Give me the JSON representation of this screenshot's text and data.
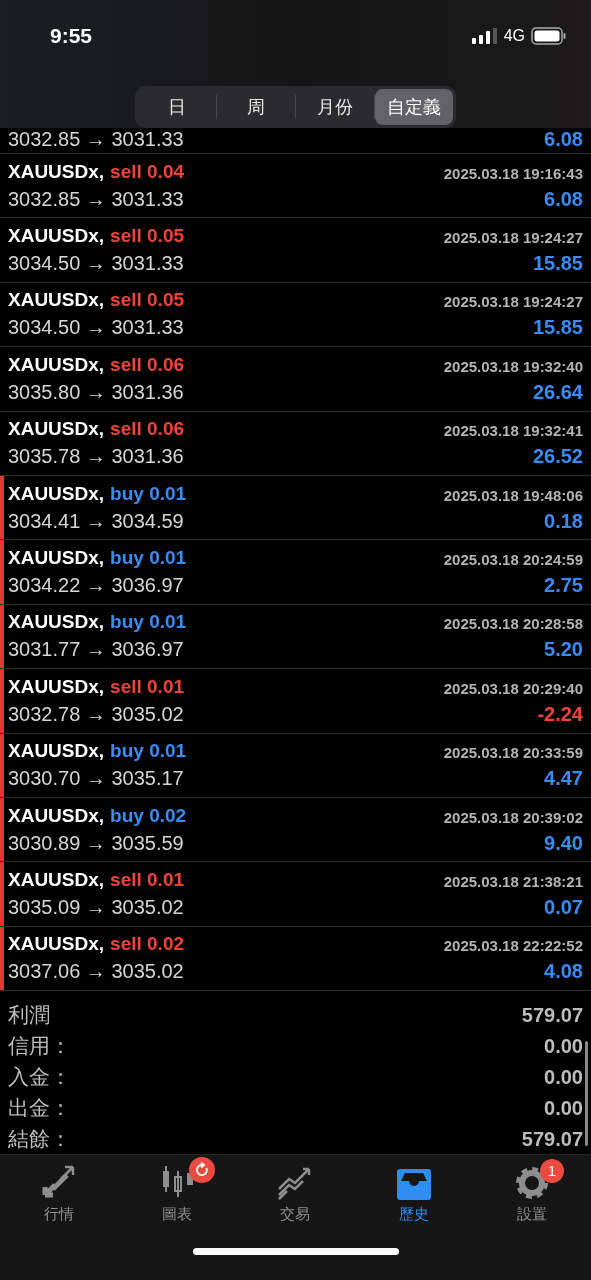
{
  "status_bar": {
    "time": "9:55",
    "network": "4G"
  },
  "period_tabs": [
    {
      "label": "日",
      "selected": false
    },
    {
      "label": "周",
      "selected": false
    },
    {
      "label": "月份",
      "selected": false
    },
    {
      "label": "自定義",
      "selected": true
    }
  ],
  "top_row": {
    "prices": "3032.85 → 3031.33",
    "profit": "6.08",
    "loss": false
  },
  "deals": [
    {
      "symbol": "XAUUSDx,",
      "order": "sell 0.04",
      "kind": "sell",
      "time": "2025.03.18 19:16:43",
      "prices": "3032.85 → 3031.33",
      "profit": "6.08",
      "loss": false,
      "flagged": false
    },
    {
      "symbol": "XAUUSDx,",
      "order": "sell 0.05",
      "kind": "sell",
      "time": "2025.03.18 19:24:27",
      "prices": "3034.50 → 3031.33",
      "profit": "15.85",
      "loss": false,
      "flagged": false
    },
    {
      "symbol": "XAUUSDx,",
      "order": "sell 0.05",
      "kind": "sell",
      "time": "2025.03.18 19:24:27",
      "prices": "3034.50 → 3031.33",
      "profit": "15.85",
      "loss": false,
      "flagged": false
    },
    {
      "symbol": "XAUUSDx,",
      "order": "sell 0.06",
      "kind": "sell",
      "time": "2025.03.18 19:32:40",
      "prices": "3035.80 → 3031.36",
      "profit": "26.64",
      "loss": false,
      "flagged": false
    },
    {
      "symbol": "XAUUSDx,",
      "order": "sell 0.06",
      "kind": "sell",
      "time": "2025.03.18 19:32:41",
      "prices": "3035.78 → 3031.36",
      "profit": "26.52",
      "loss": false,
      "flagged": false
    },
    {
      "symbol": "XAUUSDx,",
      "order": "buy 0.01",
      "kind": "buy",
      "time": "2025.03.18 19:48:06",
      "prices": "3034.41 → 3034.59",
      "profit": "0.18",
      "loss": false,
      "flagged": true
    },
    {
      "symbol": "XAUUSDx,",
      "order": "buy 0.01",
      "kind": "buy",
      "time": "2025.03.18 20:24:59",
      "prices": "3034.22 → 3036.97",
      "profit": "2.75",
      "loss": false,
      "flagged": true
    },
    {
      "symbol": "XAUUSDx,",
      "order": "buy 0.01",
      "kind": "buy",
      "time": "2025.03.18 20:28:58",
      "prices": "3031.77 → 3036.97",
      "profit": "5.20",
      "loss": false,
      "flagged": true
    },
    {
      "symbol": "XAUUSDx,",
      "order": "sell 0.01",
      "kind": "sell",
      "time": "2025.03.18 20:29:40",
      "prices": "3032.78 → 3035.02",
      "profit": "-2.24",
      "loss": true,
      "flagged": true
    },
    {
      "symbol": "XAUUSDx,",
      "order": "buy 0.01",
      "kind": "buy",
      "time": "2025.03.18 20:33:59",
      "prices": "3030.70 → 3035.17",
      "profit": "4.47",
      "loss": false,
      "flagged": true
    },
    {
      "symbol": "XAUUSDx,",
      "order": "buy 0.02",
      "kind": "buy",
      "time": "2025.03.18 20:39:02",
      "prices": "3030.89 → 3035.59",
      "profit": "9.40",
      "loss": false,
      "flagged": true
    },
    {
      "symbol": "XAUUSDx,",
      "order": "sell 0.01",
      "kind": "sell",
      "time": "2025.03.18 21:38:21",
      "prices": "3035.09 → 3035.02",
      "profit": "0.07",
      "loss": false,
      "flagged": true
    },
    {
      "symbol": "XAUUSDx,",
      "order": "sell 0.02",
      "kind": "sell",
      "time": "2025.03.18 22:22:52",
      "prices": "3037.06 → 3035.02",
      "profit": "4.08",
      "loss": false,
      "flagged": true
    }
  ],
  "summary": [
    {
      "label": "利潤",
      "value": "579.07"
    },
    {
      "label": "信用：",
      "value": "0.00"
    },
    {
      "label": "入金：",
      "value": "0.00"
    },
    {
      "label": "出金：",
      "value": "0.00"
    },
    {
      "label": "結餘：",
      "value": "579.07"
    }
  ],
  "tab_bar": [
    {
      "label": "行情",
      "kind": "quotes",
      "selected": false
    },
    {
      "label": "圖表",
      "kind": "chart",
      "selected": false,
      "refresh_badge": true
    },
    {
      "label": "交易",
      "kind": "trade",
      "selected": false
    },
    {
      "label": "歷史",
      "kind": "history",
      "selected": true
    },
    {
      "label": "設置",
      "kind": "settings",
      "selected": false,
      "badge": "1"
    }
  ]
}
